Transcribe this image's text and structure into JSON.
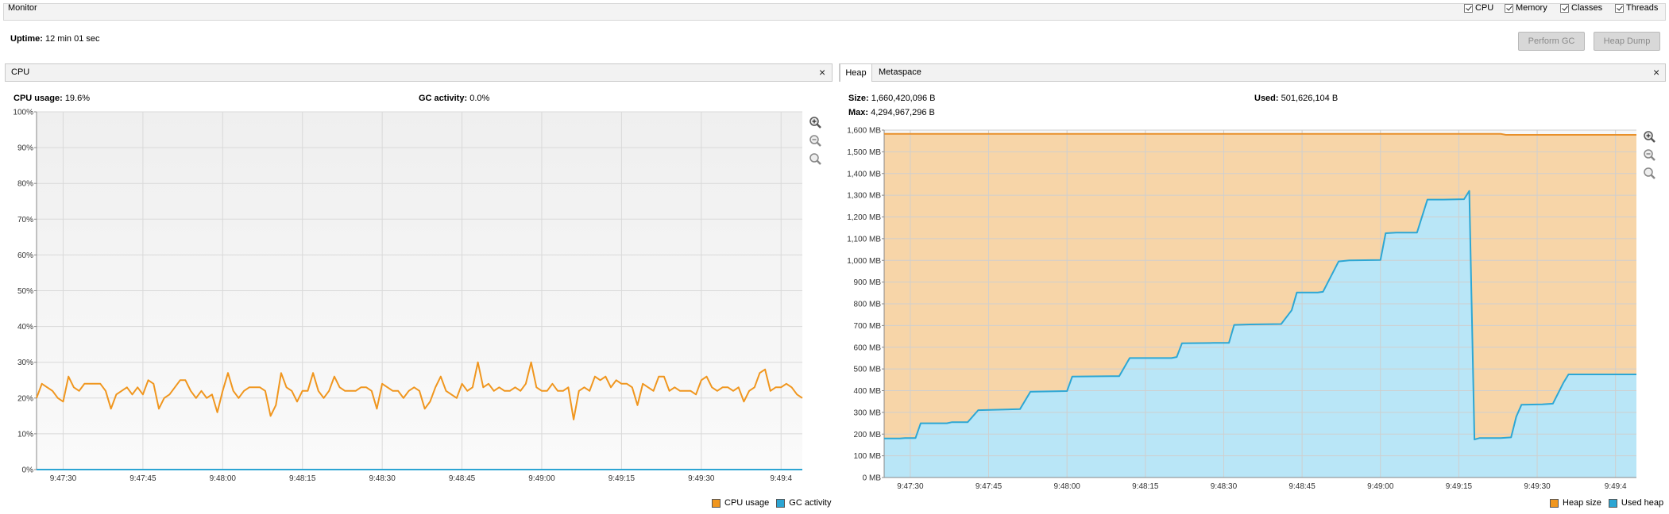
{
  "monitor": {
    "title": "Monitor",
    "checkboxes": [
      {
        "label": "CPU",
        "checked": true
      },
      {
        "label": "Memory",
        "checked": true
      },
      {
        "label": "Classes",
        "checked": true
      },
      {
        "label": "Threads",
        "checked": true
      }
    ],
    "uptime_label": "Uptime:",
    "uptime_value": "12 min 01 sec",
    "perform_gc": "Perform GC",
    "heap_dump": "Heap Dump"
  },
  "cpu_panel": {
    "title": "CPU",
    "close": "×",
    "cpu_usage_label": "CPU usage:",
    "cpu_usage_value": "19.6%",
    "gc_activity_label": "GC activity:",
    "gc_activity_value": "0.0%",
    "legend": [
      "CPU usage",
      "GC activity"
    ]
  },
  "heap_panel": {
    "tabs": [
      "Heap",
      "Metaspace"
    ],
    "close": "×",
    "size_label": "Size:",
    "size_value": "1,660,420,096 B",
    "used_label": "Used:",
    "used_value": "501,626,104 B",
    "max_label": "Max:",
    "max_value": "4,294,967,296 B",
    "legend": [
      "Heap size",
      "Used heap"
    ]
  },
  "icons": [
    "zoom-in-icon",
    "zoom-out-icon",
    "zoom-fit-icon"
  ],
  "colors": {
    "cpu_line": "#F0961E",
    "gc_line": "#2CA5D3",
    "heap_fill": "#F7D5A8",
    "heap_line": "#E8902A",
    "used_fill": "#B9E6F7",
    "used_line": "#2DA7D4"
  },
  "chart_data": [
    {
      "type": "line",
      "title": "CPU",
      "x_ticks": [
        "9:47:30",
        "9:47:45",
        "9:48:00",
        "9:48:15",
        "9:48:30",
        "9:48:45",
        "9:49:00",
        "9:49:15",
        "9:49:30",
        "9:49:4"
      ],
      "y_ticks": [
        "0%",
        "10%",
        "20%",
        "30%",
        "40%",
        "50%",
        "60%",
        "70%",
        "80%",
        "90%",
        "100%"
      ],
      "ylim": [
        0,
        100
      ],
      "x_range_seconds": [
        0,
        144
      ],
      "series": [
        {
          "name": "CPU usage",
          "values": [
            20,
            24,
            23,
            22,
            20,
            19,
            26,
            23,
            22,
            24,
            24,
            24,
            24,
            22,
            17,
            21,
            22,
            23,
            21,
            23,
            21,
            25,
            24,
            17,
            20,
            21,
            23,
            25,
            25,
            22,
            20,
            22,
            20,
            21,
            16,
            22,
            27,
            22,
            20,
            22,
            23,
            23,
            23,
            22,
            15,
            18,
            27,
            23,
            22,
            19,
            22,
            22,
            27,
            22,
            20,
            22,
            26,
            23,
            22,
            22,
            22,
            23,
            23,
            22,
            17,
            24,
            23,
            22,
            22,
            20,
            22,
            23,
            22,
            17,
            19,
            23,
            26,
            22,
            21,
            20,
            24,
            22,
            23,
            30,
            23,
            24,
            22,
            23,
            22,
            22,
            23,
            22,
            24,
            30,
            23,
            22,
            22,
            24,
            22,
            22,
            23,
            14,
            22,
            23,
            22,
            26,
            25,
            26,
            23,
            25,
            24,
            24,
            23,
            18,
            24,
            23,
            22,
            26,
            26,
            22,
            23,
            22,
            22,
            22,
            21,
            25,
            26,
            23,
            22,
            23,
            23,
            22,
            23,
            19,
            22,
            23,
            27,
            28,
            22,
            23,
            23,
            24,
            23,
            21,
            20
          ],
          "color": "#F0961E"
        },
        {
          "name": "GC activity",
          "values": [
            0,
            0
          ],
          "color": "#2CA5D3"
        }
      ]
    },
    {
      "type": "area",
      "title": "Heap",
      "x_ticks": [
        "9:47:30",
        "9:47:45",
        "9:48:00",
        "9:48:15",
        "9:48:30",
        "9:48:45",
        "9:49:00",
        "9:49:15",
        "9:49:30",
        "9:49:4"
      ],
      "y_ticks": [
        "0 MB",
        "100 MB",
        "200 MB",
        "300 MB",
        "400 MB",
        "500 MB",
        "600 MB",
        "700 MB",
        "800 MB",
        "900 MB",
        "1,000 MB",
        "1,100 MB",
        "1,200 MB",
        "1,300 MB",
        "1,400 MB",
        "1,500 MB",
        "1,600 MB"
      ],
      "ylim": [
        0,
        1600
      ],
      "x_range_seconds": [
        0,
        144
      ],
      "series": [
        {
          "name": "Heap size",
          "points": [
            [
              0,
              1583
            ],
            [
              118,
              1583
            ],
            [
              119,
              1578
            ],
            [
              144,
              1578
            ]
          ],
          "color": "#E8902A"
        },
        {
          "name": "Used heap",
          "points": [
            [
              0,
              180
            ],
            [
              3,
              180
            ],
            [
              4,
              182
            ],
            [
              6,
              182
            ],
            [
              7,
              250
            ],
            [
              12,
              250
            ],
            [
              13,
              255
            ],
            [
              16,
              255
            ],
            [
              18,
              310
            ],
            [
              21,
              312
            ],
            [
              26,
              315
            ],
            [
              28,
              395
            ],
            [
              35,
              398
            ],
            [
              36,
              465
            ],
            [
              45,
              467
            ],
            [
              47,
              550
            ],
            [
              55,
              550
            ],
            [
              56,
              555
            ],
            [
              57,
              618
            ],
            [
              63,
              620
            ],
            [
              66,
              620
            ],
            [
              67,
              703
            ],
            [
              70,
              705
            ],
            [
              76,
              707
            ],
            [
              78,
              770
            ],
            [
              79,
              852
            ],
            [
              83,
              852
            ],
            [
              84,
              855
            ],
            [
              87,
              995
            ],
            [
              89,
              1000
            ],
            [
              95,
              1002
            ],
            [
              96,
              1125
            ],
            [
              98,
              1128
            ],
            [
              102,
              1128
            ],
            [
              104,
              1280
            ],
            [
              107,
              1280
            ],
            [
              111,
              1282
            ],
            [
              112,
              1320
            ],
            [
              113,
              175
            ],
            [
              114,
              182
            ],
            [
              118,
              182
            ],
            [
              120,
              185
            ],
            [
              121,
              280
            ],
            [
              122,
              335
            ],
            [
              126,
              337
            ],
            [
              128,
              340
            ],
            [
              130,
              435
            ],
            [
              131,
              475
            ],
            [
              134,
              475
            ],
            [
              144,
              475
            ]
          ],
          "color": "#2DA7D4"
        }
      ]
    }
  ]
}
